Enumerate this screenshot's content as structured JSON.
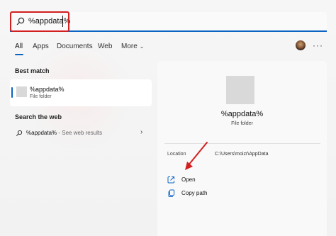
{
  "search": {
    "value": "%appdata%"
  },
  "tabs": [
    {
      "label": "All",
      "active": true
    },
    {
      "label": "Apps"
    },
    {
      "label": "Documents"
    },
    {
      "label": "Web"
    },
    {
      "label": "More"
    }
  ],
  "left": {
    "best_match_title": "Best match",
    "best_match": {
      "title": "%appdata%",
      "subtitle": "File folder"
    },
    "search_web_title": "Search the web",
    "web_result": {
      "query": "%appdata%",
      "suffix": " - See web results"
    }
  },
  "preview": {
    "title": "%appdata%",
    "subtitle": "File folder",
    "location_label": "Location",
    "location_value": "C:\\Users\\moizr\\AppData",
    "actions": [
      {
        "label": "Open",
        "icon": "open-external-icon"
      },
      {
        "label": "Copy path",
        "icon": "copy-icon"
      }
    ]
  },
  "colors": {
    "accent": "#0b63c4",
    "annotation_red": "#d21f1f",
    "panel_bg": "#f3f3f3"
  }
}
